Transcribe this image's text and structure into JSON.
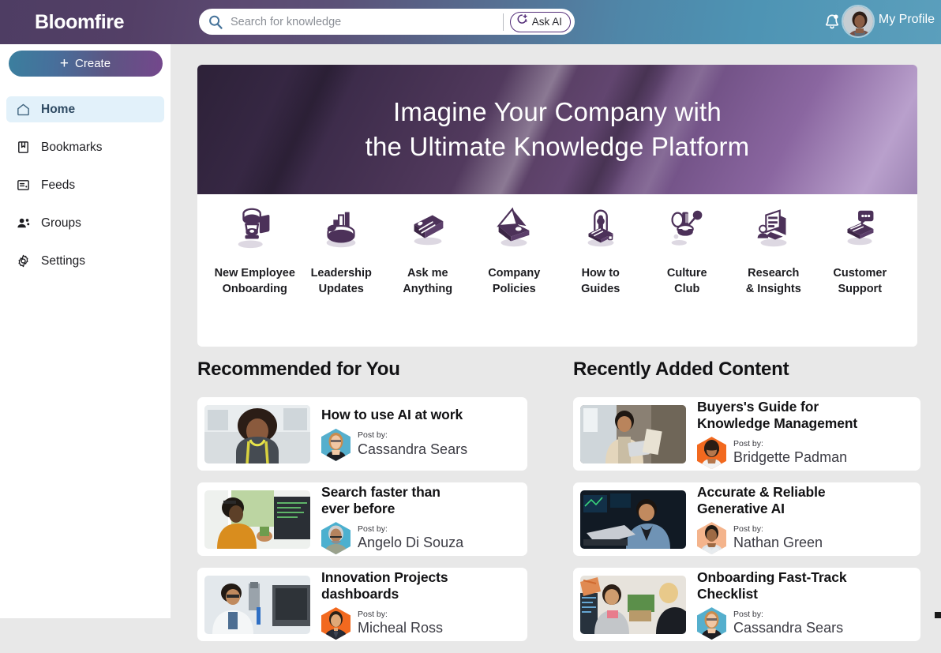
{
  "header": {
    "brand": "Bloomfire",
    "search": {
      "placeholder": "Search for knowledge",
      "value": ""
    },
    "ask_ai_label": "Ask AI",
    "profile_label": "My Profile",
    "icons": {
      "search": "search-icon",
      "ask_ai": "ai-sparkle-icon",
      "bell": "notification-bell-icon",
      "avatar": "user-avatar"
    },
    "colors": {
      "gradient_start": "#4e3d63",
      "gradient_end": "#5b9fbc"
    }
  },
  "sidebar": {
    "create_label": "Create",
    "create_colors": {
      "start": "#3b7f9e",
      "end": "#74478c"
    },
    "items": [
      {
        "label": "Home",
        "icon": "home-icon",
        "active": true
      },
      {
        "label": "Bookmarks",
        "icon": "bookmark-icon",
        "active": false
      },
      {
        "label": "Feeds",
        "icon": "feed-icon",
        "active": false
      },
      {
        "label": "Groups",
        "icon": "groups-icon",
        "active": false
      },
      {
        "label": "Settings",
        "icon": "gear-icon",
        "active": false
      }
    ],
    "active_bg": "#e2f1fa"
  },
  "hero": {
    "line1": "Imagine Your Company with",
    "line2": "the Ultimate Knowledge Platform",
    "bg_color": "#4b3557"
  },
  "categories": [
    {
      "label": "New Employee\nOnboarding",
      "icon": "coffee-maker-icon"
    },
    {
      "label": "Leadership\nUpdates",
      "icon": "podium-chart-icon"
    },
    {
      "label": "Ask me\nAnything",
      "icon": "eraser-block-icon"
    },
    {
      "label": "Company\nPolicies",
      "icon": "open-folder-icon"
    },
    {
      "label": "How to\nGuides",
      "icon": "archway-steps-icon"
    },
    {
      "label": "Culture\nClub",
      "icon": "balloon-party-icon"
    },
    {
      "label": "Research\n& Insights",
      "icon": "report-screen-icon"
    },
    {
      "label": "Customer\nSupport",
      "icon": "chat-support-icon"
    }
  ],
  "recommended": {
    "title": "Recommended for You",
    "cards": [
      {
        "title": "How to use AI at work",
        "post_by_label": "Post by:",
        "author": "Cassandra Sears",
        "avatar_bg": "#55afcd"
      },
      {
        "title": "Search faster than\never before",
        "post_by_label": "Post by:",
        "author": "Angelo Di Souza",
        "avatar_bg": "#4cb0cf"
      },
      {
        "title": "Innovation Projects\ndashboards",
        "post_by_label": "Post by:",
        "author": "Micheal Ross",
        "avatar_bg": "#f2691f"
      }
    ]
  },
  "recently_added": {
    "title": "Recently Added Content",
    "cards": [
      {
        "title": "Buyers's Guide for\nKnowledge Management",
        "post_by_label": "Post by:",
        "author": "Bridgette Padman",
        "avatar_bg": "#f2691f"
      },
      {
        "title": "Accurate & Reliable\nGenerative AI",
        "post_by_label": "Post by:",
        "author": "Nathan Green",
        "avatar_bg": "#f4b48c"
      },
      {
        "title": "Onboarding Fast-Track\nChecklist",
        "post_by_label": "Post by:",
        "author": "Cassandra Sears",
        "avatar_bg": "#55afcd"
      }
    ]
  }
}
